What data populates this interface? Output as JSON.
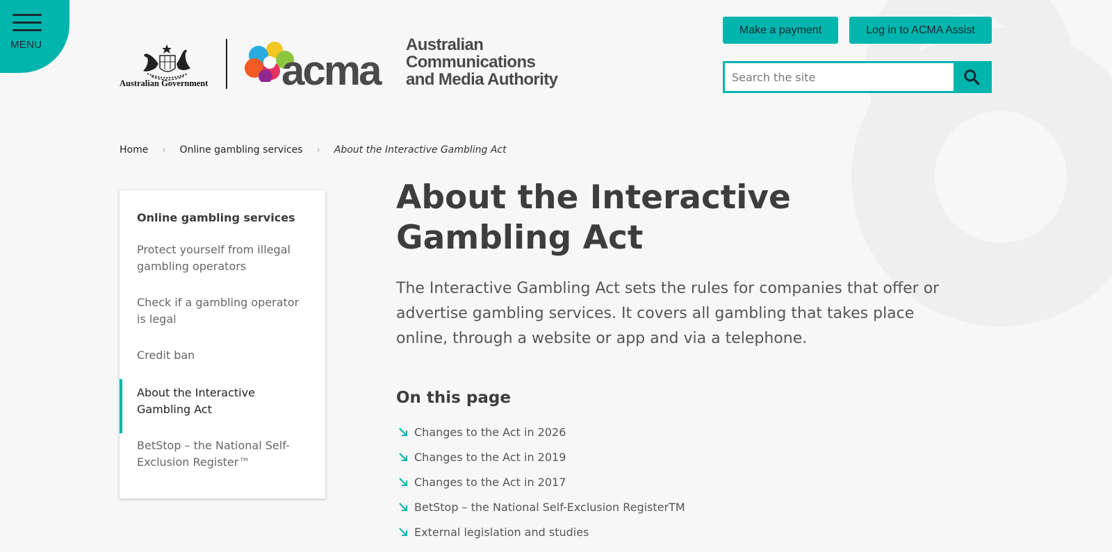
{
  "header": {
    "menu_label": "MENU",
    "gov_logo_text": "Australian Government",
    "acma_word": "acma",
    "acma_full_name": [
      "Australian",
      "Communications",
      "and Media Authority"
    ],
    "buttons": {
      "payment": "Make a payment",
      "login": "Log in to ACMA Assist"
    },
    "search": {
      "placeholder": "Search the site",
      "value": ""
    }
  },
  "breadcrumb": {
    "items": [
      "Home",
      "Online gambling services"
    ],
    "current": "About the Interactive Gambling Act"
  },
  "sidebar": {
    "title": "Online gambling services",
    "items": [
      "Protect yourself from illegal gambling operators",
      "Check if a gambling operator is legal",
      "Credit ban",
      "About the Interactive Gambling Act",
      "BetStop – the National Self-Exclusion Register™"
    ],
    "active_index": 3
  },
  "main": {
    "title": "About the Interactive Gambling Act",
    "intro": "The Interactive Gambling Act sets the rules for companies that offer or advertise gambling services. It covers all gambling that takes place online, through a website or app and via a telephone.",
    "on_this_page_heading": "On this page",
    "on_this_page_links": [
      "Changes to the Act in 2026",
      "Changes to the Act in 2019",
      "Changes to the Act in 2017",
      "BetStop – the National Self-Exclusion RegisterTM",
      "External legislation and studies"
    ]
  },
  "colors": {
    "accent": "#00b5ad",
    "text_dark": "#3d3d3d",
    "page_bg": "#f7f7f7"
  },
  "icons": {
    "menu": "hamburger-icon",
    "search": "magnifier-icon",
    "on_this_page_link": "arrow-down-right-icon",
    "breadcrumb_separator": "chevron-right-icon"
  }
}
